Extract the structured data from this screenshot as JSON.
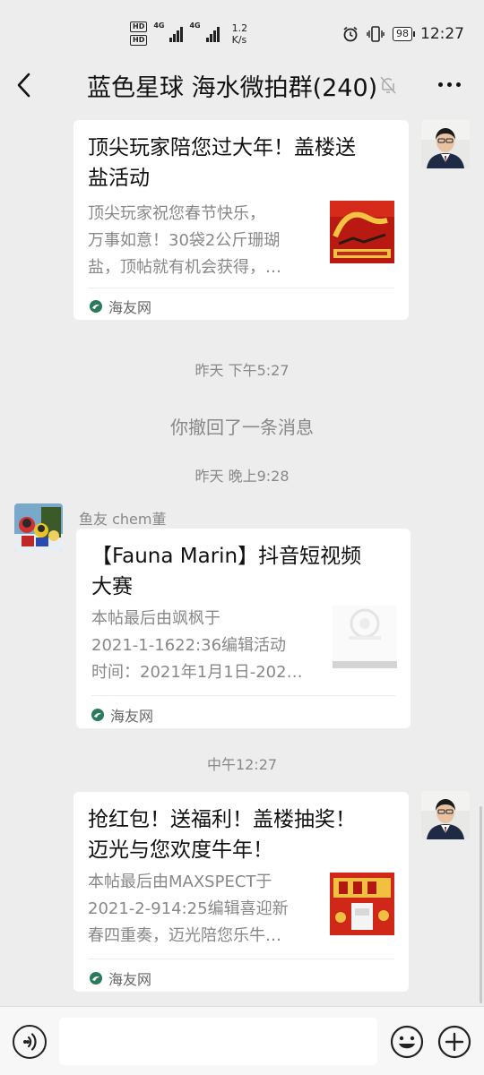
{
  "status": {
    "hd_labels": [
      "HD",
      "HD"
    ],
    "net_labels": [
      "4G",
      "4G"
    ],
    "speed_value": "1.2",
    "speed_unit": "K/s",
    "battery": "98",
    "time": "12:27"
  },
  "header": {
    "title": "蓝色星球 海水微拍群(240)",
    "back_icon": "chevron-left-icon",
    "mute_icon": "bell-muted-icon",
    "more_icon": "more-dots-icon"
  },
  "messages": {
    "m1": {
      "title_line1": "顶尖玩家陪您过大年！盖楼送",
      "title_line2": "盐活动",
      "desc_line1": "顶尖玩家祝您春节快乐，",
      "desc_line2": "万事如意！30袋2公斤珊瑚",
      "desc_line3": "盐，顶帖就有机会获得，…",
      "source": "海友网"
    },
    "time1": "昨天 下午5:27",
    "recall": "你撤回了一条消息",
    "time2": "昨天 晚上9:28",
    "m2": {
      "sender": "鱼友 chem董",
      "title_line1": "【Fauna Marin】抖音短视频",
      "title_line2": "大赛",
      "desc_line1": "本帖最后由飒枫于",
      "desc_line2": "2021-1-1622:36编辑活动",
      "desc_line3": "时间：2021年1月1日-202…",
      "source": "海友网"
    },
    "time3": "中午12:27",
    "m3": {
      "title_line1": "抢红包！送福利！盖楼抽奖！",
      "title_line2": "迈光与您欢度牛年！",
      "desc_line1": "本帖最后由MAXSPECT于",
      "desc_line2": "2021-2-914:25编辑喜迎新",
      "desc_line3": "春四重奏，迈光陪您乐牛…",
      "source": "海友网"
    }
  },
  "input": {
    "value": "",
    "placeholder": "",
    "voice_icon": "voice-icon",
    "emoji_icon": "emoji-icon",
    "plus_icon": "plus-icon"
  }
}
